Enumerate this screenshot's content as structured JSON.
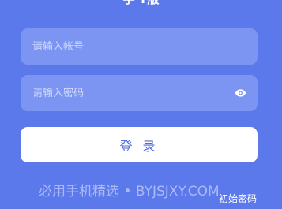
{
  "header": {
    "title": "手 Ÿ版"
  },
  "login_form": {
    "username": {
      "placeholder": "请输入帐号",
      "value": ""
    },
    "password": {
      "placeholder": "请输入密码",
      "value": "",
      "toggle_icon": "eye-icon"
    },
    "submit_label": "登 录"
  },
  "footer": {
    "watermark": "必用手机精选 • BYJSJXY.COM",
    "initial_password_link": "初始密码"
  },
  "colors": {
    "background": "#5c79eb",
    "input_background": "#7c94f2",
    "button_background": "#ffffff",
    "button_text": "#4f6bd9"
  }
}
